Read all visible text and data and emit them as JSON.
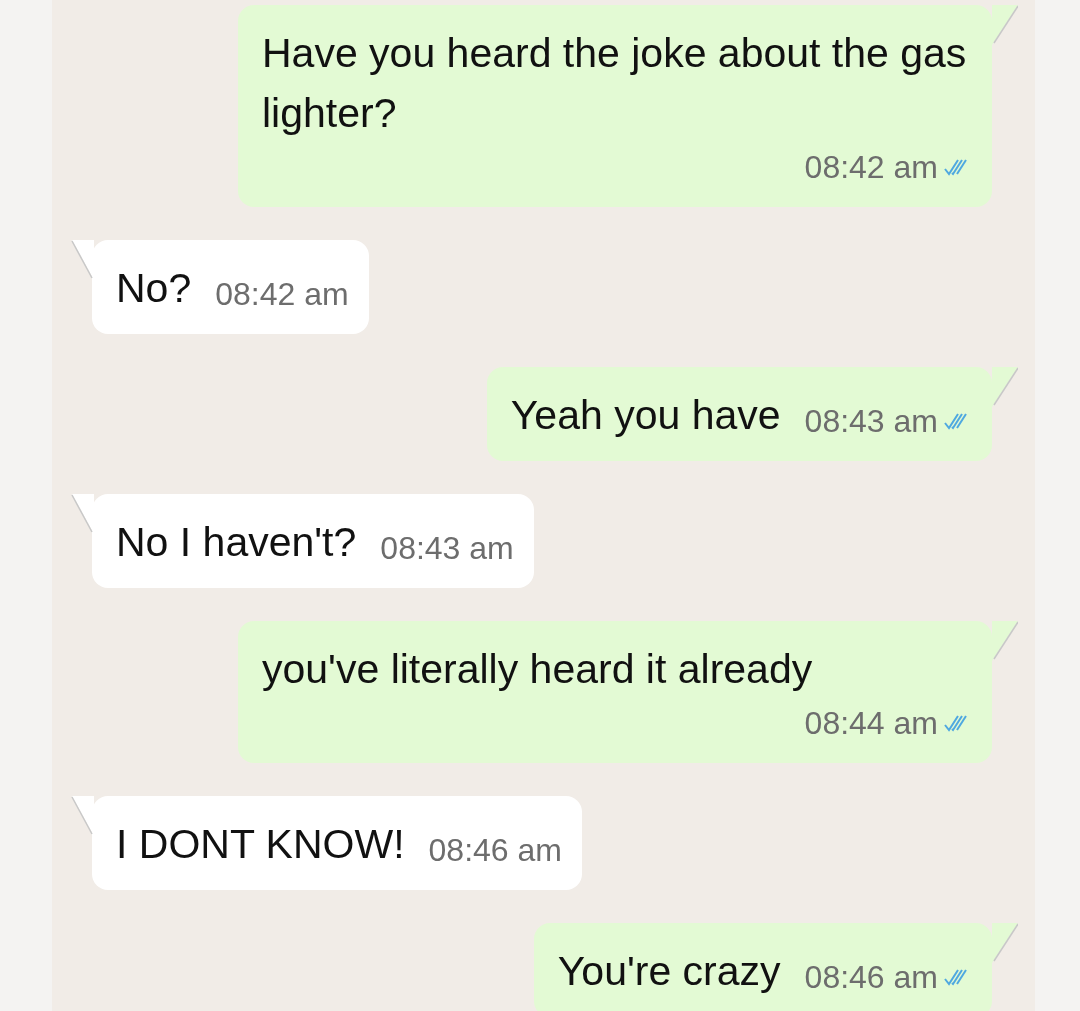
{
  "messages": [
    {
      "kind": "outgoing",
      "text": "Have you heard the joke about the gas lighter?",
      "time": "08:42 am",
      "read": true
    },
    {
      "kind": "incoming",
      "text": "No?",
      "time": "08:42 am"
    },
    {
      "kind": "outgoing",
      "text": "Yeah you have",
      "time": "08:43 am",
      "read": true
    },
    {
      "kind": "incoming",
      "text": "No I haven't?",
      "time": "08:43 am"
    },
    {
      "kind": "outgoing",
      "text": "you've literally heard it already",
      "time": "08:44 am",
      "read": true
    },
    {
      "kind": "incoming",
      "text": "I DONT KNOW!",
      "time": "08:46 am"
    },
    {
      "kind": "outgoing",
      "text": "You're crazy",
      "time": "08:46 am",
      "read": true
    }
  ]
}
